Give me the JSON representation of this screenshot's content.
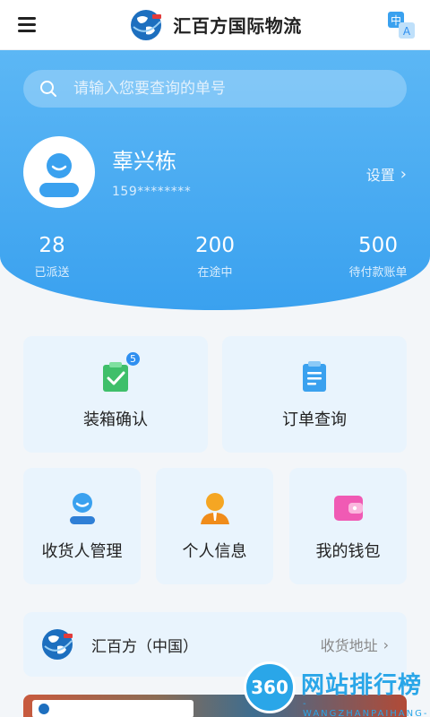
{
  "header": {
    "title": "汇百方国际物流",
    "logo_icon": "globe-logo-icon",
    "menu_icon": "hamburger-menu-icon",
    "translate_icon": "translate-zh-en-icon",
    "translate_glyph_zh": "中",
    "translate_glyph_en": "A"
  },
  "search": {
    "placeholder": "请输入您要查询的单号",
    "icon": "search-icon"
  },
  "user": {
    "name": "辜兴栋",
    "phone": "159********",
    "settings_label": "设置",
    "chevron": "›"
  },
  "stats": [
    {
      "value": "28",
      "label": "已派送"
    },
    {
      "value": "200",
      "label": "在途中"
    },
    {
      "value": "500",
      "label": "待付款账单"
    }
  ],
  "actions": [
    {
      "label": "装箱确认",
      "icon": "packing-confirm-icon",
      "badge": "5"
    },
    {
      "label": "订单查询",
      "icon": "order-query-icon"
    },
    {
      "label": "收货人管理",
      "icon": "consignee-icon"
    },
    {
      "label": "个人信息",
      "icon": "personal-info-icon"
    },
    {
      "label": "我的钱包",
      "icon": "wallet-icon"
    }
  ],
  "address": {
    "name": "汇百方（中国）",
    "link_label": "收货地址",
    "chevron": "›"
  },
  "watermark": {
    "badge": "360",
    "title": "网站排行榜",
    "subtitle": "-WANGZHANPAIHANG-"
  },
  "colors": {
    "accent": "#3aa1ef",
    "card_bg": "#e9f4fd",
    "badge": "#2f8ff0"
  }
}
